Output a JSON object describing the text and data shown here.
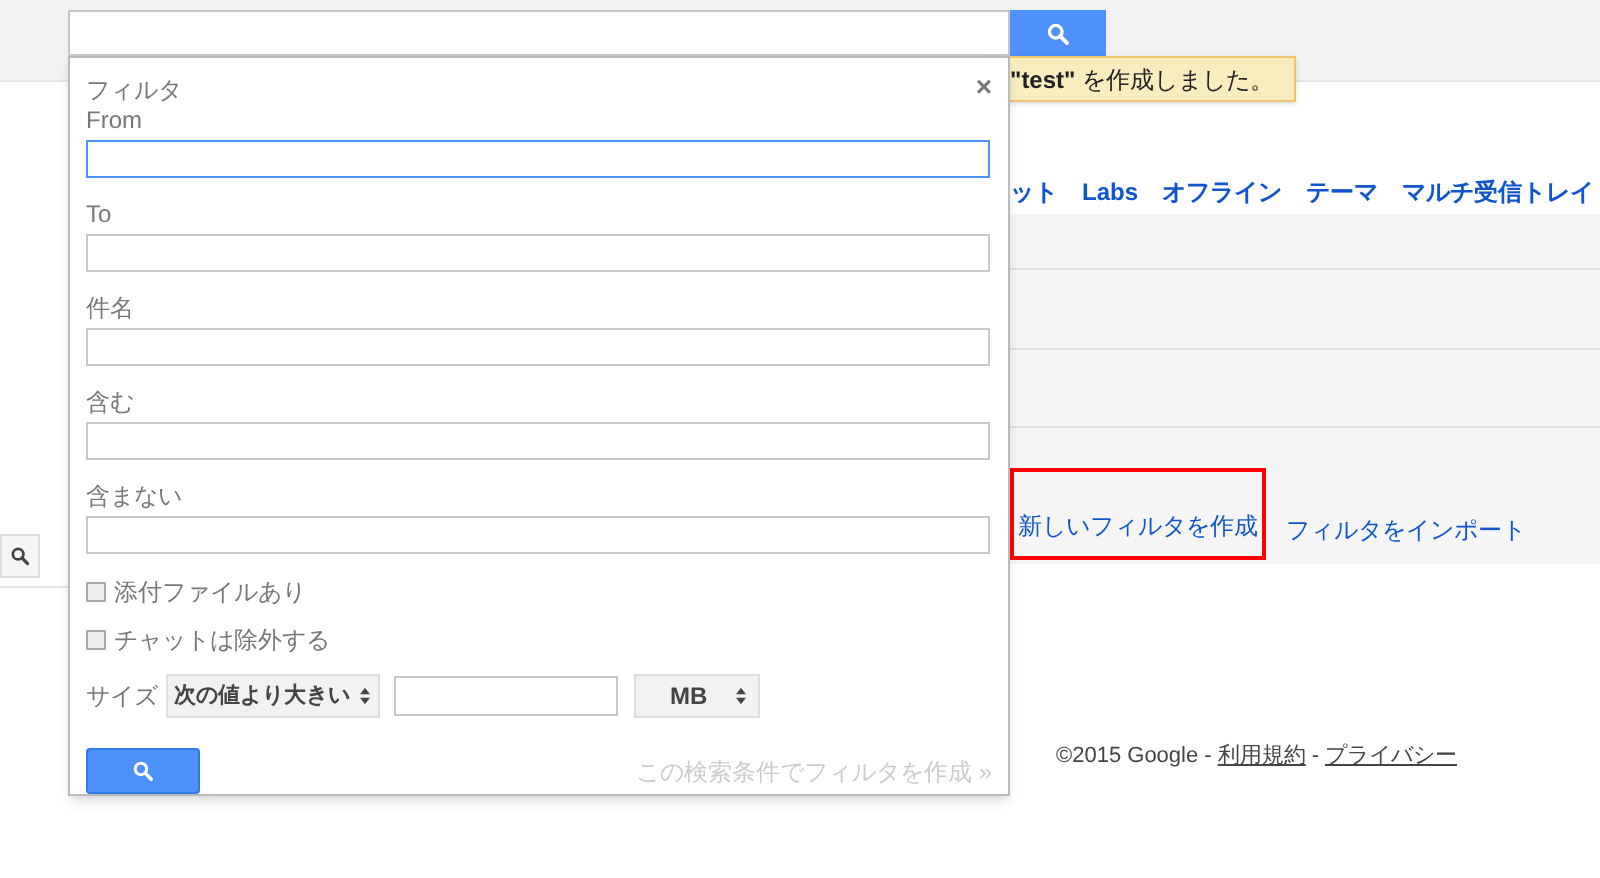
{
  "toast": {
    "text": "**\"test\"** を作成しました。"
  },
  "nav_links": [
    "ット",
    "Labs",
    "オフライン",
    "テーマ",
    "マルチ受信トレイ"
  ],
  "filter_actions": [
    {
      "label": "新しいフィルタを作成",
      "highlighted": true
    },
    {
      "label": "フィルタをインポート",
      "highlighted": false
    }
  ],
  "footer": {
    "copyright": "©2015 Google -",
    "terms": "利用規約",
    "separator": "-",
    "privacy": "プライバシー"
  },
  "filter_panel": {
    "title": "フィルタ",
    "close": "×",
    "fields": [
      {
        "label": "From",
        "focused": true
      },
      {
        "label": "To",
        "focused": false
      },
      {
        "label": "件名",
        "focused": false
      },
      {
        "label": "含む",
        "focused": false
      },
      {
        "label": "含まない",
        "focused": false
      }
    ],
    "checkboxes": [
      {
        "label": "添付ファイルあり",
        "checked": false
      },
      {
        "label": "チャットは除外する",
        "checked": false
      }
    ],
    "size": {
      "label": "サイズ",
      "operator": "次の値より大きい",
      "unit": "MB"
    },
    "create_link": "この検索条件でフィルタを作成 »"
  }
}
